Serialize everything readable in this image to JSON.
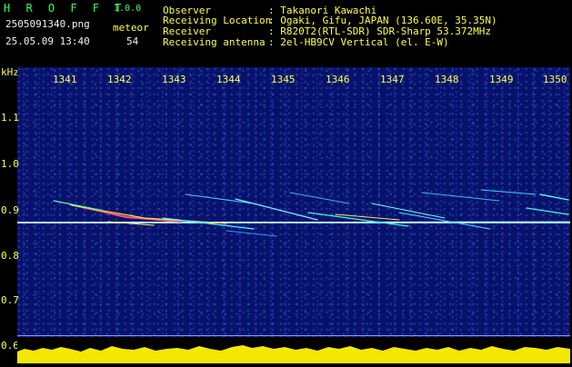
{
  "app": {
    "name": "H R O F F T",
    "version": "1.0.0"
  },
  "file": "2505091340.png",
  "datetime": "25.05.09 13:40",
  "meteor": {
    "label": "meteor",
    "count": "54"
  },
  "info": [
    {
      "label": "Observer",
      "value": ": Takanori Kawachi"
    },
    {
      "label": "Receiving Location",
      "value": ": Ogaki, Gifu, JAPAN (136.60E, 35.35N)"
    },
    {
      "label": "Receiver",
      "value": ": R820T2(RTL-SDR) SDR-Sharp 53.372MHz"
    },
    {
      "label": "Receiving antenna",
      "value": ": 2el-HB9CV Vertical (el. E-W)"
    }
  ],
  "axis": {
    "y_unit": "kHz",
    "x_ticks": [
      "1341",
      "1342",
      "1343",
      "1344",
      "1345",
      "1346",
      "1347",
      "1348",
      "1349",
      "1350"
    ],
    "y_ticks": [
      "1.1",
      "1.0",
      "0.9",
      "0.8",
      "0.7",
      "0.6"
    ]
  },
  "colors": {
    "background": "#000000",
    "plot_bg": "#07126b",
    "header_green": "#39ff5a",
    "label_yellow": "#ffff4a"
  }
}
